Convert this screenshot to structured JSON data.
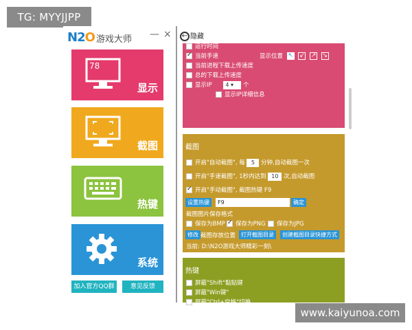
{
  "watermark": {
    "top_left": "TG: MYYJJPP",
    "bottom_right": "www.kaiyunoa.com"
  },
  "left": {
    "logo_n": "N",
    "logo_2": "2",
    "logo_o": "O",
    "title": "游戏大师",
    "minimize": "—",
    "close": "×",
    "tiles": [
      {
        "label": "显示",
        "color": "#e43a6c",
        "number": "78"
      },
      {
        "label": "截图",
        "color": "#f0a91e"
      },
      {
        "label": "热键",
        "color": "#8cc33f"
      },
      {
        "label": "系统",
        "color": "#2a94d6"
      }
    ],
    "buttons": {
      "qq": "加入官方QQ群",
      "feedback": "意见反馈"
    }
  },
  "right": {
    "back_icon": "←",
    "back_label": "隐藏",
    "display_panel": {
      "rows": [
        {
          "label": "运行时间",
          "checked": false
        },
        {
          "label": "当前手速",
          "checked": true
        },
        {
          "label": "当前进程下载上传速度",
          "checked": false
        },
        {
          "label": "总的下载上传速度",
          "checked": false
        },
        {
          "label": "显示IP",
          "checked": false
        }
      ],
      "position_label": "显示位置",
      "position_icons": [
        "↖",
        "↙",
        "↗",
        "↘"
      ],
      "ip_count": "4 ▾",
      "ip_unit": "个",
      "ip_detail": "显示IP详细信息"
    },
    "screenshot_panel": {
      "title": "截图",
      "auto_prefix": "开启\"自动截图\", 每",
      "auto_value": "5",
      "auto_suffix": "分钟,自动截图一次",
      "speed_prefix": "开启\"手速截图\", 1秒内达到",
      "speed_value": "10",
      "speed_suffix": "次,自动截图",
      "manual": "开启\"手动截图\", 截图热键 F9",
      "set_hotkey": "设置热键",
      "hotkey_value": "F9",
      "confirm": "确定",
      "format_title": "截图图片保存格式",
      "formats": [
        {
          "label": "保存为BMP",
          "checked": false
        },
        {
          "label": "保存为PNG",
          "checked": true
        },
        {
          "label": "保存为JPG",
          "checked": false
        }
      ],
      "modify": "修改",
      "save_location": "截图存放位置",
      "open_dir": "打开截图目录",
      "create_shortcut": "创建截图目录快捷方式",
      "current": "当前: D:\\N2O游戏大师精彩一刻\\"
    },
    "hotkey_panel": {
      "title": "热键",
      "rows": [
        {
          "label": "屏蔽\"Shift\"黏贴键"
        },
        {
          "label": "屏蔽\"Win键\""
        },
        {
          "label": "屏蔽\"Ctrl+空格\"切换"
        }
      ]
    }
  }
}
